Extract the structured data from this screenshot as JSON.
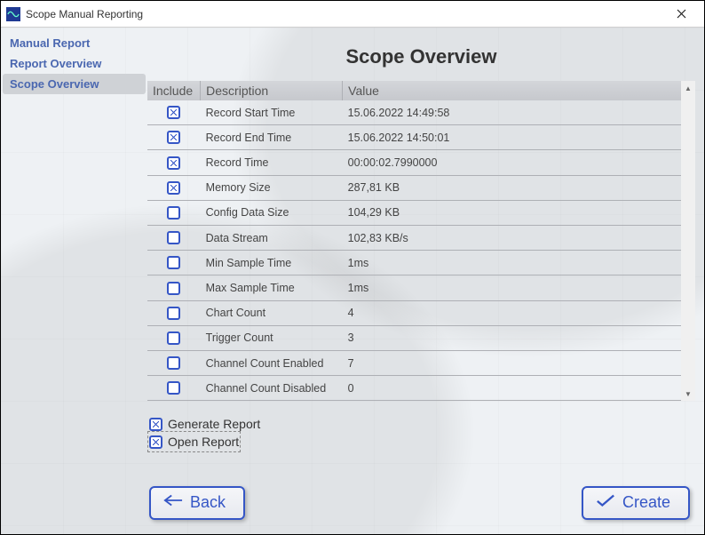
{
  "window": {
    "title": "Scope Manual Reporting"
  },
  "sidebar": {
    "items": [
      {
        "label": "Manual Report",
        "selected": false
      },
      {
        "label": "Report Overview",
        "selected": false
      },
      {
        "label": "Scope Overview",
        "selected": true
      }
    ]
  },
  "main": {
    "title": "Scope Overview",
    "columns": {
      "include": "Include",
      "description": "Description",
      "value": "Value"
    },
    "rows": [
      {
        "include": true,
        "description": "Record Start Time",
        "value": "15.06.2022 14:49:58"
      },
      {
        "include": true,
        "description": "Record End Time",
        "value": "15.06.2022 14:50:01"
      },
      {
        "include": true,
        "description": "Record Time",
        "value": "00:00:02.7990000"
      },
      {
        "include": true,
        "description": "Memory Size",
        "value": "287,81 KB"
      },
      {
        "include": false,
        "description": "Config Data Size",
        "value": "104,29 KB"
      },
      {
        "include": false,
        "description": "Data Stream",
        "value": "102,83 KB/s"
      },
      {
        "include": false,
        "description": "Min Sample Time",
        "value": "1ms"
      },
      {
        "include": false,
        "description": "Max Sample Time",
        "value": "1ms"
      },
      {
        "include": false,
        "description": "Chart Count",
        "value": "4"
      },
      {
        "include": false,
        "description": "Trigger Count",
        "value": "3"
      },
      {
        "include": false,
        "description": "Channel Count Enabled",
        "value": "7"
      },
      {
        "include": false,
        "description": "Channel Count Disabled",
        "value": "0"
      }
    ],
    "options": {
      "generate": {
        "label": "Generate Report",
        "checked": true
      },
      "open": {
        "label": "Open Report",
        "checked": true,
        "focused": true
      }
    },
    "buttons": {
      "back": "Back",
      "create": "Create"
    }
  },
  "colors": {
    "accent": "#3556c6"
  }
}
